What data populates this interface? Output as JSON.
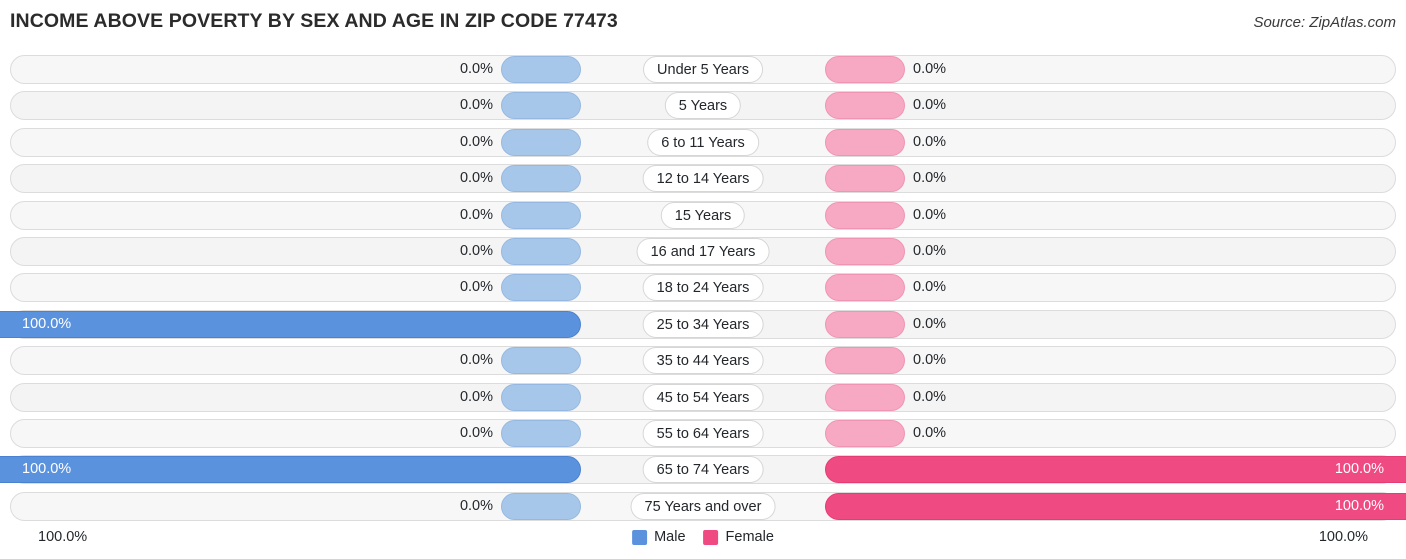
{
  "header": {
    "title": "INCOME ABOVE POVERTY BY SEX AND AGE IN ZIP CODE 77473",
    "source": "Source: ZipAtlas.com"
  },
  "legend": {
    "male_label": "Male",
    "female_label": "Female",
    "male_color": "#5b92dd",
    "female_color": "#ef4a82"
  },
  "axis": {
    "left_label": "100.0%",
    "right_label": "100.0%"
  },
  "chart_data": {
    "type": "bar",
    "title": "INCOME ABOVE POVERTY BY SEX AND AGE IN ZIP CODE 77473",
    "subtitle": "Source: ZipAtlas.com",
    "orientation": "horizontal-diverging",
    "xlabel": "",
    "ylabel": "",
    "xlim": [
      0,
      100
    ],
    "grid": false,
    "legend_position": "bottom-center",
    "categories": [
      "Under 5 Years",
      "5 Years",
      "6 to 11 Years",
      "12 to 14 Years",
      "15 Years",
      "16 and 17 Years",
      "18 to 24 Years",
      "25 to 34 Years",
      "35 to 44 Years",
      "45 to 54 Years",
      "55 to 64 Years",
      "65 to 74 Years",
      "75 Years and over"
    ],
    "series": [
      {
        "name": "Male",
        "color": "#5b92dd",
        "values": [
          0.0,
          0.0,
          0.0,
          0.0,
          0.0,
          0.0,
          0.0,
          100.0,
          0.0,
          0.0,
          0.0,
          100.0,
          0.0
        ],
        "labels": [
          "0.0%",
          "0.0%",
          "0.0%",
          "0.0%",
          "0.0%",
          "0.0%",
          "0.0%",
          "100.0%",
          "0.0%",
          "0.0%",
          "0.0%",
          "100.0%",
          "0.0%"
        ]
      },
      {
        "name": "Female",
        "color": "#ef4a82",
        "values": [
          0.0,
          0.0,
          0.0,
          0.0,
          0.0,
          0.0,
          0.0,
          0.0,
          0.0,
          0.0,
          0.0,
          100.0,
          100.0
        ],
        "labels": [
          "0.0%",
          "0.0%",
          "0.0%",
          "0.0%",
          "0.0%",
          "0.0%",
          "0.0%",
          "0.0%",
          "0.0%",
          "0.0%",
          "0.0%",
          "100.0%",
          "100.0%"
        ]
      }
    ]
  }
}
